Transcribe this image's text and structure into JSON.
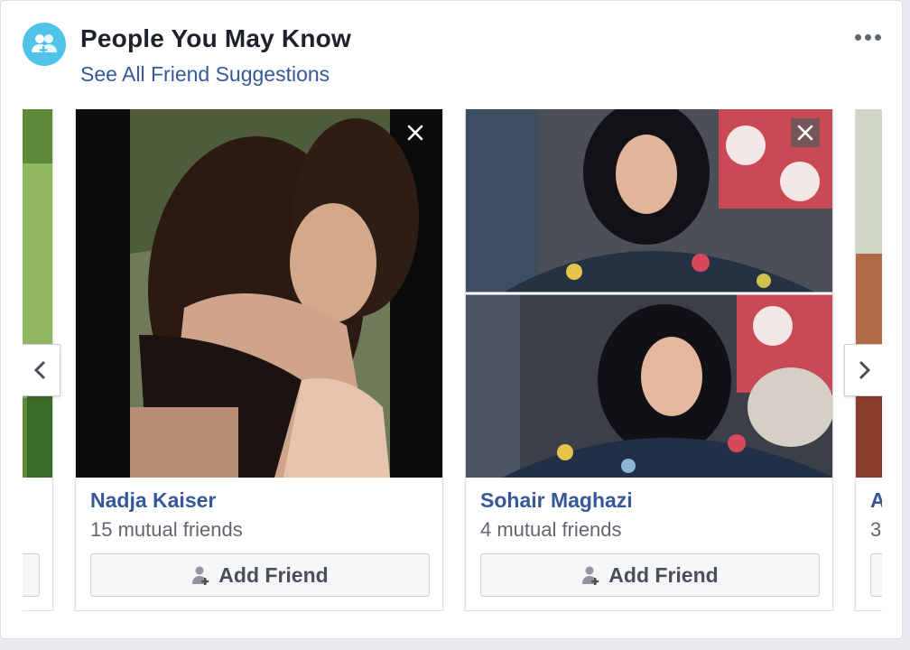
{
  "header": {
    "title": "People You May Know",
    "link": "See All Friend Suggestions",
    "icon": "friends-icon"
  },
  "colors": {
    "link": "#365899",
    "icon_bg": "#4fc3e8",
    "button_bg": "#f5f6f7"
  },
  "cards": [
    {
      "name": "Nadja Kaiser",
      "mutual": "15 mutual friends",
      "button": "Add Friend"
    },
    {
      "name": "Sohair Maghazi",
      "mutual": "4 mutual friends",
      "button": "Add Friend"
    },
    {
      "name": "A",
      "mutual": "3"
    }
  ],
  "controls": {
    "prev": "chevron-left-icon",
    "next": "chevron-right-icon",
    "more": "more-options-icon"
  }
}
